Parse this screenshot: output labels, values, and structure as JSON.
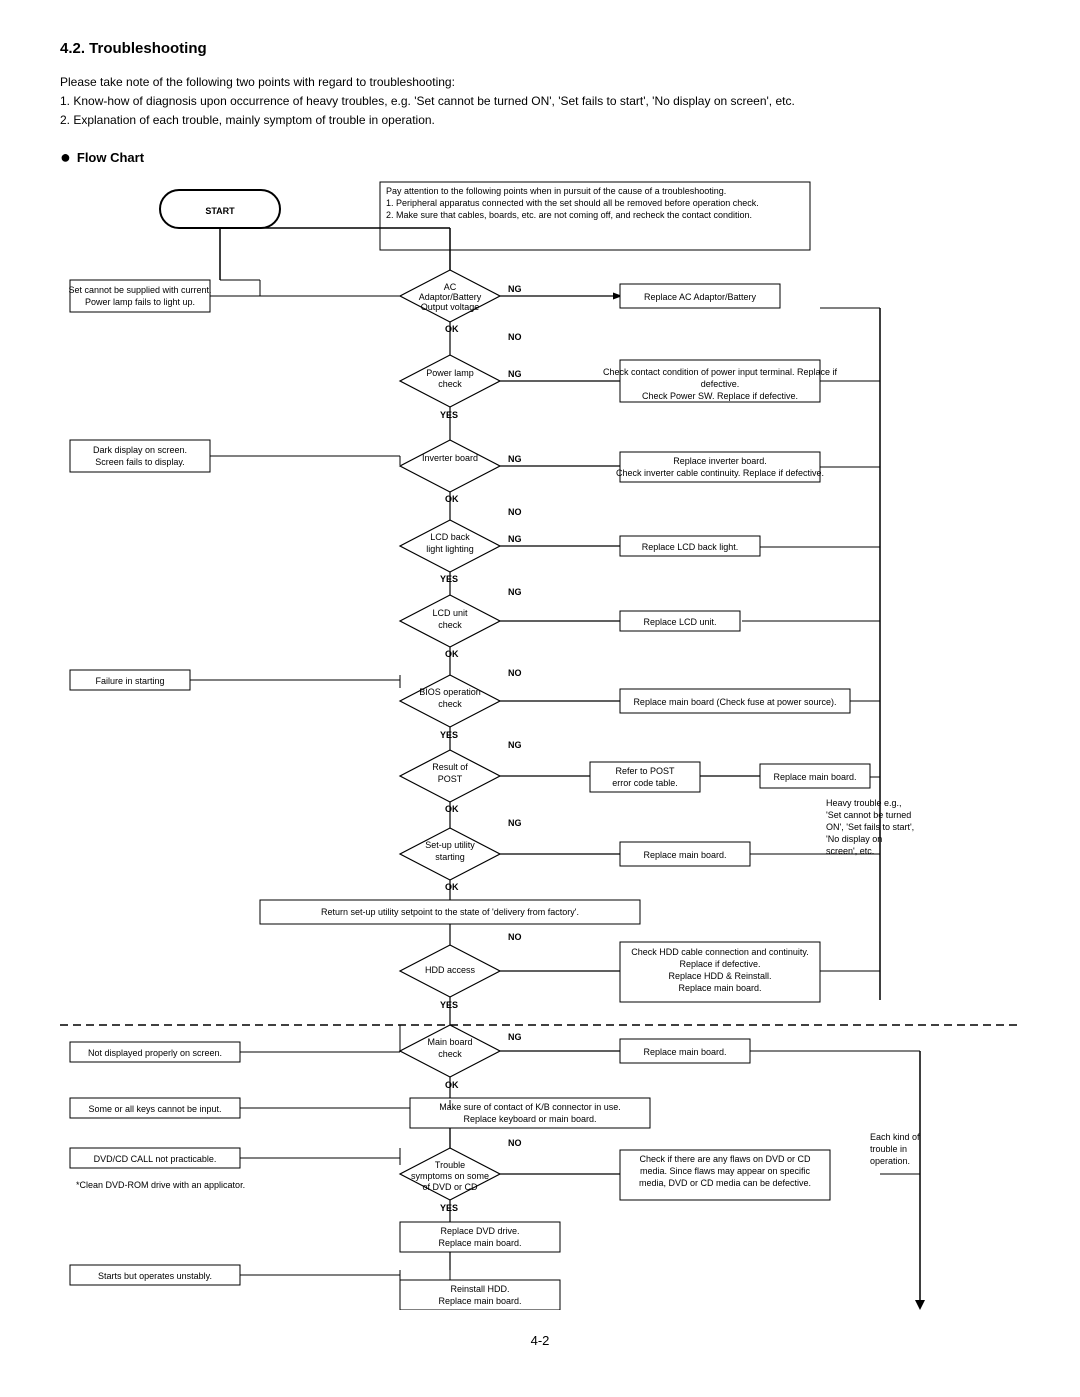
{
  "title": "4.2.  Troubleshooting",
  "intro": {
    "line0": "Please take note of the following two points with regard to troubleshooting:",
    "line1": "1. Know-how of diagnosis upon occurrence of heavy troubles, e.g. 'Set cannot be turned ON', 'Set fails to start', 'No display on screen', etc.",
    "line2": "2. Explanation of each trouble, mainly symptom of trouble in operation."
  },
  "section_title": "Flow Chart",
  "page_number": "4-2"
}
